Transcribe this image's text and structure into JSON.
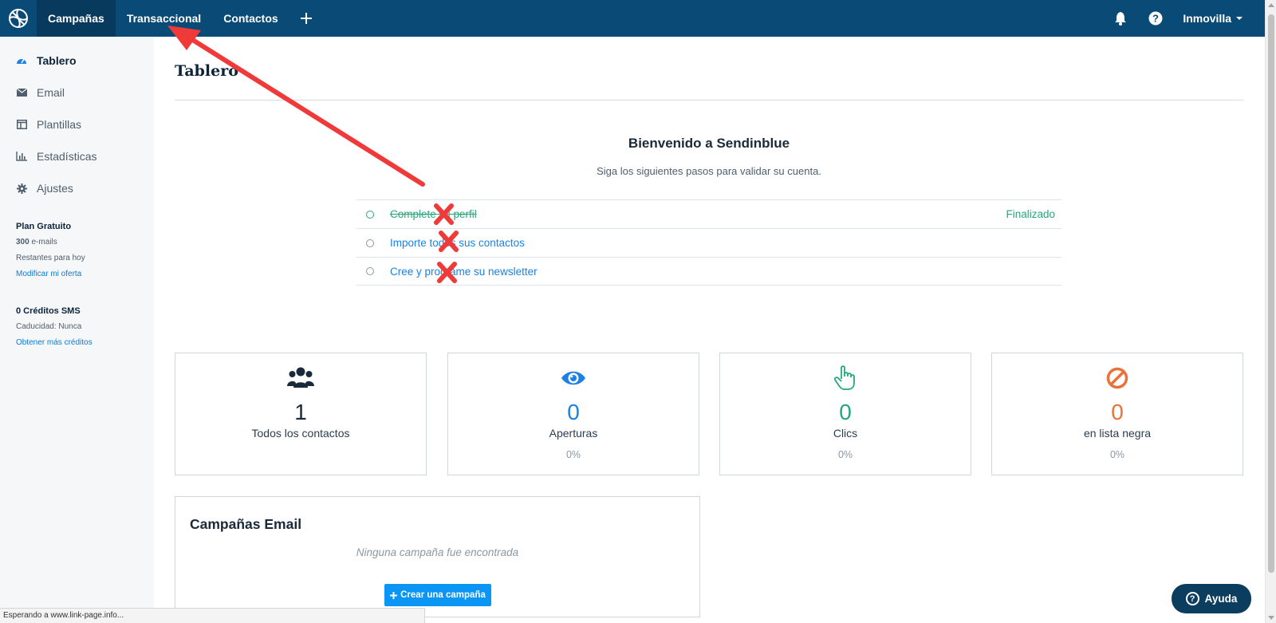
{
  "topbar": {
    "tabs": [
      {
        "label": "Campañas"
      },
      {
        "label": "Transaccional"
      },
      {
        "label": "Contactos"
      }
    ],
    "account": "Inmovilla"
  },
  "sidebar": {
    "items": [
      {
        "label": "Tablero",
        "icon": "dashboard-icon"
      },
      {
        "label": "Email",
        "icon": "envelope-icon"
      },
      {
        "label": "Plantillas",
        "icon": "template-icon"
      },
      {
        "label": "Estadísticas",
        "icon": "chart-icon"
      },
      {
        "label": "Ajustes",
        "icon": "gear-icon"
      }
    ],
    "plan": {
      "title": "Plan Gratuito",
      "emails_count": "300",
      "emails_unit": " e-mails",
      "remaining": "Restantes para hoy",
      "link": "Modificar mi oferta"
    },
    "sms": {
      "title": "0 Créditos SMS",
      "expiry": "Caducidad: Nunca",
      "link": "Obtener más créditos"
    }
  },
  "main": {
    "title": "Tablero",
    "welcome": {
      "title": "Bienvenido a Sendinblue",
      "subtitle": "Siga los siguientes pasos para validar su cuenta."
    },
    "steps": [
      {
        "label": "Complete su perfil",
        "status": "Finalizado"
      },
      {
        "label": "Importe todos sus contactos"
      },
      {
        "label": "Cree y programe su newsletter"
      }
    ],
    "stats": [
      {
        "value": "1",
        "label": "Todos los contactos",
        "color": "#1b2a3a",
        "icon": "users-icon"
      },
      {
        "value": "0",
        "label": "Aperturas",
        "pct": "0%",
        "color": "#1b81e5",
        "icon": "eye-icon"
      },
      {
        "value": "0",
        "label": "Clics",
        "pct": "0%",
        "color": "#24a879",
        "icon": "pointer-hand-icon"
      },
      {
        "value": "0",
        "label": "en lista negra",
        "pct": "0%",
        "color": "#e8733a",
        "icon": "blocked-icon"
      }
    ],
    "campaigns": {
      "title": "Campañas Email",
      "empty": "Ninguna campaña fue encontrada",
      "create_button": "Crear una campaña"
    }
  },
  "statusbar": "Esperando a www.link-page.info...",
  "help_button": "Ayuda",
  "colors": {
    "topbar": "#0a4a77",
    "accent": "#0b96f5",
    "success": "#24a879",
    "annotation_red": "#f03a3a"
  }
}
